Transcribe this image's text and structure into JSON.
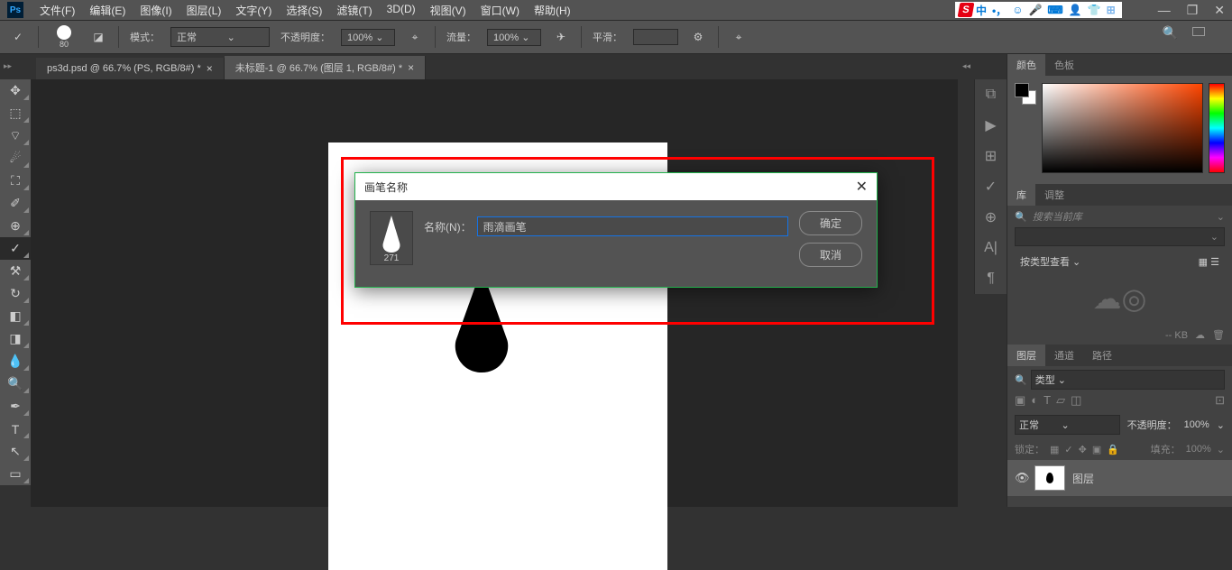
{
  "menu": [
    "文件(F)",
    "编辑(E)",
    "图像(I)",
    "图层(L)",
    "文字(Y)",
    "选择(S)",
    "滤镜(T)",
    "3D(D)",
    "视图(V)",
    "窗口(W)",
    "帮助(H)"
  ],
  "ime": {
    "cn": "中"
  },
  "options": {
    "brush_size": "80",
    "mode_label": "模式：",
    "mode_value": "正常",
    "opacity_label": "不透明度：",
    "opacity_value": "100%",
    "flow_label": "流量：",
    "flow_value": "100%",
    "smooth_label": "平滑："
  },
  "tabs": [
    {
      "label": "ps3d.psd @ 66.7% (PS, RGB/8#) *"
    },
    {
      "label": "未标题-1 @ 66.7% (图层 1, RGB/8#) *"
    }
  ],
  "dialog": {
    "title": "画笔名称",
    "name_label": "名称(N)：",
    "name_value": "雨滴画笔",
    "brush_num": "271",
    "ok": "确定",
    "cancel": "取消"
  },
  "panels": {
    "color_tab": "颜色",
    "swatch_tab": "色板",
    "lib_tab": "库",
    "adjust_tab": "调整",
    "search_placeholder": "搜索当前库",
    "view_label": "按类型查看",
    "kb_label": "-- KB",
    "layer_tab": "图层",
    "channel_tab": "通道",
    "path_tab": "路径",
    "kind_label": "类型",
    "mode_value": "正常",
    "opacity_label": "不透明度：",
    "opacity_value": "100%",
    "lock_label": "锁定：",
    "fill_label": "填充：",
    "fill_value": "100%",
    "layer1_name": "图层"
  }
}
